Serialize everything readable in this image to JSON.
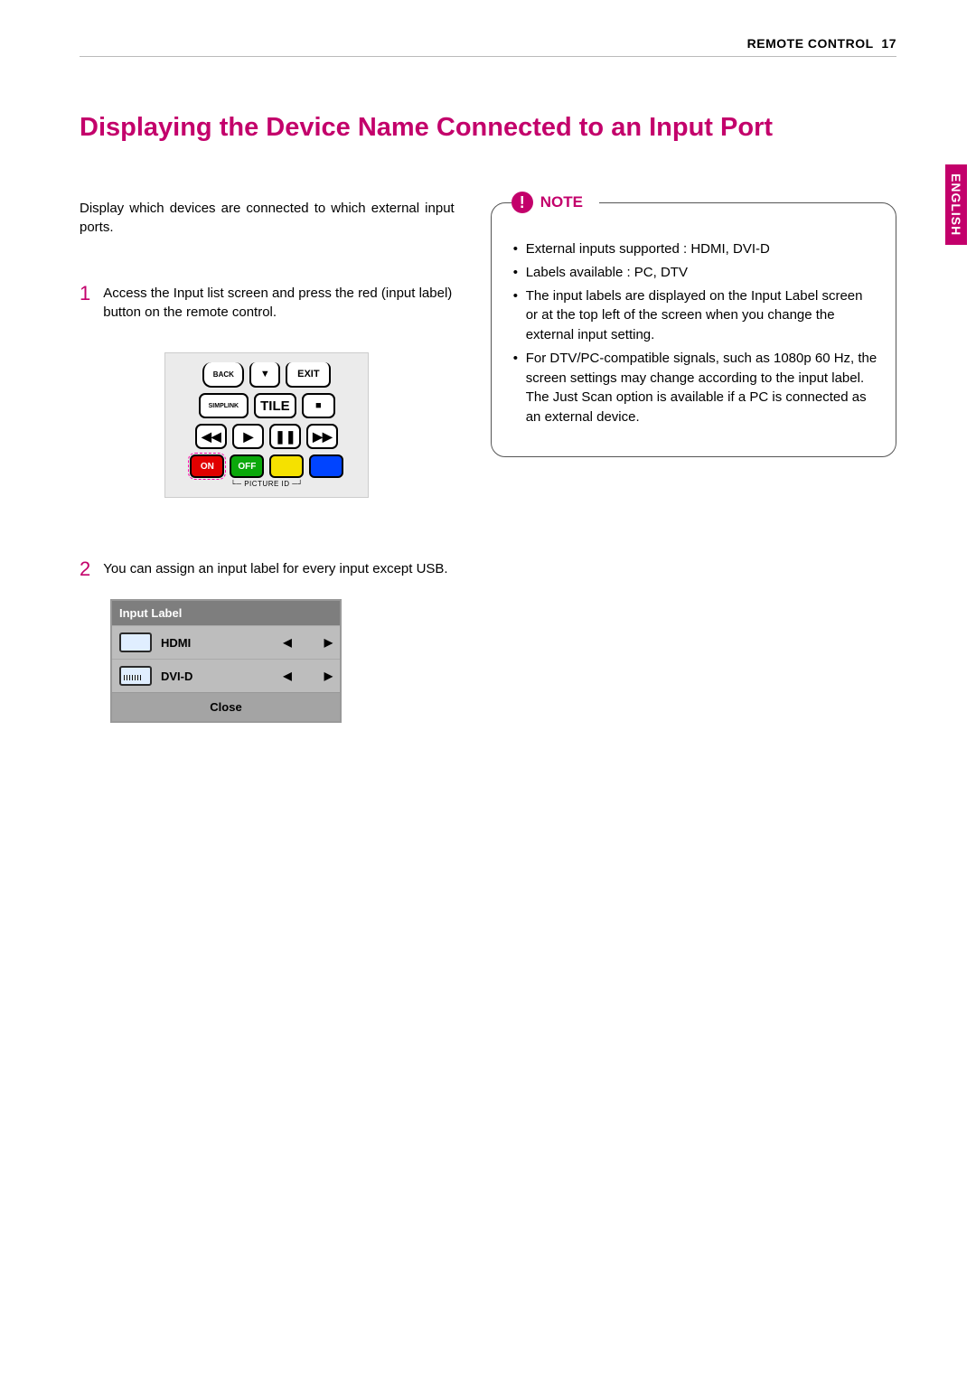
{
  "header": {
    "section": "REMOTE CONTROL",
    "page_number": "17"
  },
  "title": "Displaying the Device Name Connected to an Input Port",
  "intro": "Display which devices are connected to which external input ports.",
  "steps": [
    {
      "num": "1",
      "text": "Access the Input list screen and press the red (input label) button on the remote control."
    },
    {
      "num": "2",
      "text": "You can assign an input label for every input except USB."
    }
  ],
  "remote": {
    "back": "BACK",
    "down": "▼",
    "exit": "EXIT",
    "simplink": "SIMPLINK",
    "tile": "TILE",
    "stop": "■",
    "rew": "◀◀",
    "play": "▶",
    "pause": "❚❚",
    "ffwd": "▶▶",
    "on": "ON",
    "off": "OFF",
    "picture_id": "PICTURE ID"
  },
  "input_label_fig": {
    "header": "Input Label",
    "rows": [
      {
        "label": "HDMI"
      },
      {
        "label": "DVI-D"
      }
    ],
    "left": "◀",
    "right": "▶",
    "close": "Close"
  },
  "note": {
    "title": "NOTE",
    "items": [
      "External inputs supported : HDMI, DVI-D",
      "Labels available : PC, DTV",
      "The input labels are displayed on the Input Label screen or at the top left of the screen when you change the external input setting.",
      "For DTV/PC-compatible signals, such as 1080p 60 Hz, the screen settings may change according to the input label. The Just Scan option is available if a PC is connected as an external device."
    ]
  },
  "side_tab": "ENGLISH"
}
